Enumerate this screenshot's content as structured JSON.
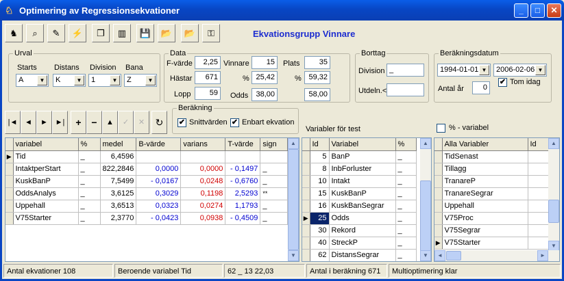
{
  "window": {
    "title": "Optimering av Regressionsekvationer",
    "minimize": "_",
    "maximize": "□",
    "close": "✕"
  },
  "toolbar": {
    "icons": [
      "horse-icon",
      "binoculars-icon",
      "pen-icon",
      "wand-icon",
      "copy-icon",
      "book-icon",
      "save-icon",
      "open-folder-icon",
      "open-folder-2-icon",
      "key-icon"
    ],
    "glyphs": [
      "♞",
      "⌕",
      "✎",
      "⚡",
      "❐",
      "▥",
      "💾",
      "📂",
      "📂",
      "⚿"
    ],
    "group_title": "Ekvationsgrupp Vinnare"
  },
  "urval": {
    "caption": "Urval",
    "starts_label": "Starts",
    "starts_value": "A",
    "distans_label": "Distans",
    "distans_value": "K",
    "division_label": "Division",
    "division_value": "1",
    "bana_label": "Bana",
    "bana_value": "Z"
  },
  "data": {
    "caption": "Data",
    "fvarde_label": "F-värde",
    "fvarde": "2,25",
    "hastar_label": "Hästar",
    "hastar": "671",
    "lopp_label": "Lopp",
    "lopp": "59",
    "vinnare_label": "Vinnare",
    "vinnare": "15",
    "vinn_pct_label": "%",
    "vinn_pct": "25,42",
    "odds_label": "Odds",
    "odds1": "38,00",
    "plats_label": "Plats",
    "plats": "35",
    "plats_pct_label": "%",
    "plats_pct": "59,32",
    "odds2": "58,00"
  },
  "bortag": {
    "caption": "Borttag",
    "division_label": "Division",
    "division_value": "_",
    "utdeln_label": "Utdeln.<",
    "utdeln_value": ""
  },
  "berdatum": {
    "caption": "Beräkningsdatum",
    "from": "1994-01-01",
    "to": "2006-02-06",
    "antal_ar_label": "Antal år",
    "antal_ar": "0",
    "tom_idag_label": "Tom idag",
    "tom_idag_check": "✔"
  },
  "berakning": {
    "caption": "Beräkning",
    "snitt_label": "Snittvärden",
    "snitt_check": "✔",
    "enbart_label": "Enbart ekvation",
    "enbart_check": "✔"
  },
  "nav": {
    "first": "|◄",
    "prev": "◄",
    "next": "►",
    "last": "►|",
    "add": "+",
    "remove": "−",
    "up": "▲",
    "confirm": "✓",
    "cancel": "✕",
    "refresh": "↻"
  },
  "variabler_label": "Variabler för test",
  "pct_variabel_label": "% - variabel",
  "main_table": {
    "headers": [
      "variabel",
      "%",
      "medel",
      "B-värde",
      "varians",
      "T-värde",
      "sign"
    ],
    "rows": [
      [
        "Tid",
        "_",
        "6,4596",
        "",
        "",
        "",
        ""
      ],
      [
        "IntaktperStart",
        "_",
        "822,2846",
        "0,0000",
        "0,0000",
        "- 0,1497",
        "_"
      ],
      [
        "KuskBanP",
        "_",
        "7,5499",
        "- 0,0167",
        "0,0248",
        "- 0,6760",
        "_"
      ],
      [
        "OddsAnalys",
        "_",
        "3,6125",
        "0,3029",
        "0,1198",
        "2,5293",
        "**"
      ],
      [
        "Uppehall",
        "_",
        "3,6513",
        "0,0323",
        "0,0274",
        "1,1793",
        "_"
      ],
      [
        "V75Starter",
        "_",
        "2,3770",
        "- 0,0423",
        "0,0938",
        "- 0,4509",
        "_"
      ]
    ]
  },
  "test_table": {
    "headers": [
      "Id",
      "Variabel",
      "%"
    ],
    "rows": [
      [
        "5",
        "BanP",
        "_"
      ],
      [
        "8",
        "InbForluster",
        "_"
      ],
      [
        "10",
        "Intakt",
        "_"
      ],
      [
        "15",
        "KuskBanP",
        "_"
      ],
      [
        "16",
        "KuskBanSegrar",
        "_"
      ],
      [
        "25",
        "Odds",
        "_"
      ],
      [
        "30",
        "Rekord",
        "_"
      ],
      [
        "40",
        "StreckP",
        "_"
      ],
      [
        "62",
        "DistansSegrar",
        "_"
      ]
    ]
  },
  "all_table": {
    "headers": [
      "Alla Variabler",
      "Id"
    ],
    "rows": [
      "TidSenast",
      "Tillagg",
      "TranareP",
      "TranareSegrar",
      "Uppehall",
      "V75Proc",
      "V75Segrar",
      "V75Starter"
    ]
  },
  "status": {
    "s1": "Antal ekvationer 108",
    "s2": "Beroende variabel Tid",
    "s3": "62 _ 13  22,03",
    "s4": "Antal i beräkning 671",
    "s5": "Multioptimering klar"
  }
}
